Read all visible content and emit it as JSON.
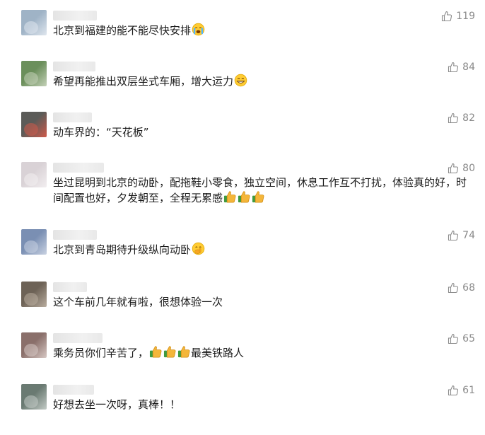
{
  "comments": [
    {
      "nickname": "",
      "text": "北京到福建的能不能尽快安排",
      "emojis": [
        "crying-face-icon"
      ],
      "likes": "119",
      "avatar_colors": [
        "#9fb3c6",
        "#dfe6ee"
      ]
    },
    {
      "nickname": "",
      "text": "希望再能推出双层坐式车厢，增大运力",
      "emojis": [
        "grinning-face-icon"
      ],
      "likes": "84",
      "avatar_colors": [
        "#6b8f5b",
        "#c4d1b8"
      ]
    },
    {
      "nickname": "",
      "text": "动车界的：“天花板”",
      "emojis": [],
      "likes": "82",
      "avatar_colors": [
        "#5b5b58",
        "#d05a4a"
      ]
    },
    {
      "nickname": "",
      "text": "坐过昆明到北京的动卧，配拖鞋小零食，独立空间，休息工作互不打扰，体验真的好，时间配置也好，夕发朝至，全程无累感",
      "emojis": [
        "thumbs-up-icon",
        "thumbs-up-icon",
        "thumbs-up-icon"
      ],
      "likes": "80",
      "avatar_colors": [
        "#d9d2d6",
        "#f2eef0"
      ]
    },
    {
      "nickname": "",
      "text": "北京到青岛期待升级纵向动卧",
      "emojis": [
        "shushing-face-icon"
      ],
      "likes": "74",
      "avatar_colors": [
        "#7a8fb3",
        "#c9d2e2"
      ]
    },
    {
      "nickname": "",
      "text": "这个车前几年就有啦，很想体验一次",
      "emojis": [],
      "likes": "68",
      "avatar_colors": [
        "#6d6256",
        "#b9ad9f"
      ]
    },
    {
      "nickname": "",
      "text": "乘务员你们辛苦了，",
      "text_after": "最美铁路人",
      "emojis": [
        "thumbs-up-icon",
        "thumbs-up-icon",
        "thumbs-up-icon"
      ],
      "likes": "65",
      "avatar_colors": [
        "#8a6f6a",
        "#d7c8c4"
      ]
    },
    {
      "nickname": "",
      "text": "好想去坐一次呀，真棒！！",
      "emojis": [],
      "likes": "61",
      "avatar_colors": [
        "#6a7a72",
        "#c3cbc6"
      ]
    }
  ]
}
